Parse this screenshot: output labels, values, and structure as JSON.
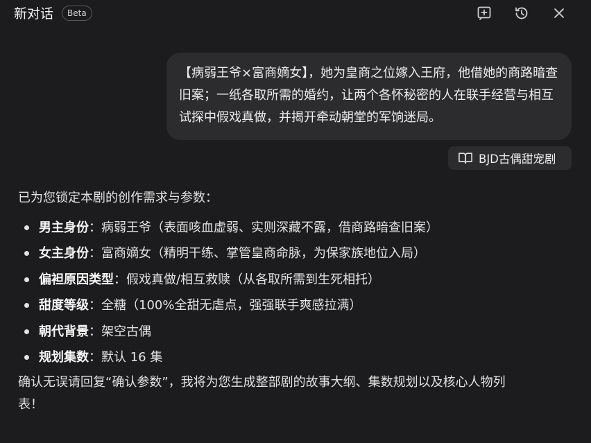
{
  "header": {
    "title": "新对话",
    "badge": "Beta",
    "icons": [
      "add-note-icon",
      "history-icon",
      "close-icon"
    ]
  },
  "user_message": {
    "text": "【病弱王爷×富商嫡女】，她为皇商之位嫁入王府，他借她的商路暗查旧案；一纸各取所需的婚约，让两个各怀秘密的人在联手经营与相互试探中假戏真做，并揭开牵动朝堂的军饷迷局。",
    "tag_icon": "book-icon",
    "tag_label": "BJD古偶甜宠剧"
  },
  "assistant_reply": {
    "intro": "已为您锁定本剧的创作需求与参数：",
    "items": [
      {
        "key": "男主身份",
        "value": "：病弱王爷（表面咳血虚弱、实则深藏不露，借商路暗查旧案）"
      },
      {
        "key": "女主身份",
        "value": "：富商嫡女（精明干练、掌管皇商命脉，为保家族地位入局）"
      },
      {
        "key": "偏袒原因类型",
        "value": "：假戏真做/相互救赎（从各取所需到生死相托）"
      },
      {
        "key": "甜度等级",
        "value": "：全糖（100%全甜无虐点，强强联手爽感拉满）"
      },
      {
        "key": "朝代背景",
        "value": "：架空古偶"
      },
      {
        "key": "规划集数",
        "value": "：默认 16 集"
      }
    ],
    "outro": "确认无误请回复“确认参数”，我将为您生成整部剧的故事大纲、集数规划以及核心人物列表！"
  },
  "colors": {
    "background": "#1c1c1e",
    "bubble": "#2c2c2e",
    "text": "#e6e6e6"
  }
}
